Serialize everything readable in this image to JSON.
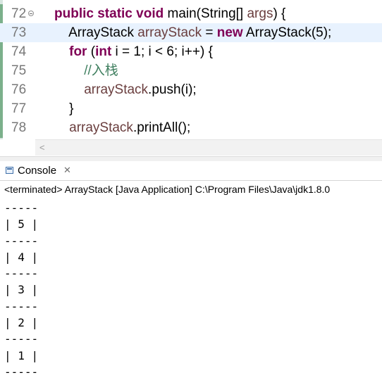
{
  "editor": {
    "lines": [
      {
        "num": "72",
        "parts": [
          [
            "kw",
            "public"
          ],
          [
            "t",
            " "
          ],
          [
            "kw",
            "static"
          ],
          [
            "t",
            " "
          ],
          [
            "kw",
            "void"
          ],
          [
            "t",
            " main(String[] "
          ],
          [
            "var",
            "args"
          ],
          [
            "t",
            ") {"
          ]
        ]
      },
      {
        "num": "73",
        "parts": [
          [
            "t",
            "    ArrayStack "
          ],
          [
            "fld",
            "arrayStack"
          ],
          [
            "t",
            " = "
          ],
          [
            "kw",
            "new"
          ],
          [
            "t",
            " ArrayStack(5);"
          ]
        ]
      },
      {
        "num": "74",
        "parts": [
          [
            "t",
            "    "
          ],
          [
            "kw",
            "for"
          ],
          [
            "t",
            " ("
          ],
          [
            "kw",
            "int"
          ],
          [
            "t",
            " i = 1; i < 6; i++) {"
          ]
        ]
      },
      {
        "num": "75",
        "parts": [
          [
            "t",
            "        "
          ],
          [
            "cmt",
            "//入栈"
          ]
        ]
      },
      {
        "num": "76",
        "parts": [
          [
            "t",
            "        "
          ],
          [
            "fld",
            "arrayStack"
          ],
          [
            "t",
            ".push(i);"
          ]
        ]
      },
      {
        "num": "77",
        "parts": [
          [
            "t",
            "    }"
          ]
        ]
      },
      {
        "num": "78",
        "parts": [
          [
            "t",
            "    "
          ],
          [
            "fld",
            "arrayStack"
          ],
          [
            "t",
            ".printAll();"
          ]
        ]
      }
    ],
    "hscroll_arrow": "<"
  },
  "console": {
    "tab_label": "Console",
    "tab_close": "✕",
    "status": "<terminated> ArrayStack [Java Application] C:\\Program Files\\Java\\jdk1.8.0",
    "output": [
      "-----",
      "| 5 |",
      "-----",
      "| 4 |",
      "-----",
      "| 3 |",
      "-----",
      "| 2 |",
      "-----",
      "| 1 |",
      "-----"
    ]
  }
}
